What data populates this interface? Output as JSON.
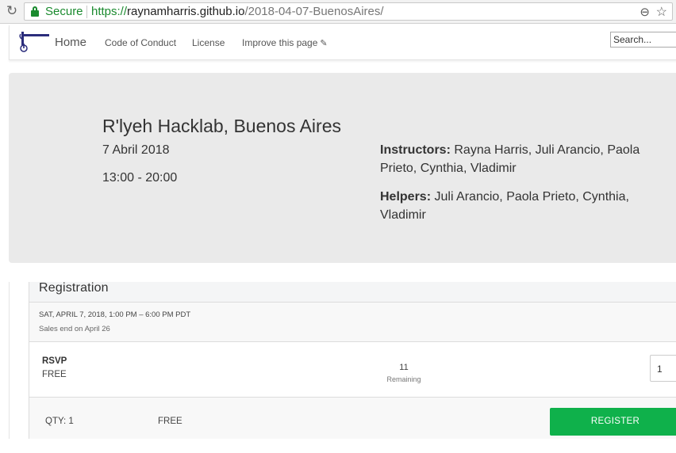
{
  "browser": {
    "secure_label": "Secure",
    "url_scheme": "https://",
    "url_host": "raynamharris.github.io",
    "url_path": "/2018-04-07-BuenosAires/",
    "reload_icon": "reload-icon",
    "zoom_icon": "zoom-icon",
    "bookmark_icon": "star-icon"
  },
  "nav": {
    "home": "Home",
    "links": [
      "Code of Conduct",
      "License",
      "Improve this page"
    ],
    "search_placeholder": "Search..."
  },
  "workshop": {
    "title": "R'lyeh Hacklab, Buenos Aires",
    "date": "7 Abril 2018",
    "time": "13:00 - 20:00",
    "instructors_label": "Instructors:",
    "instructors": "Rayna Harris, Juli Arancio, Paola Prieto, Cynthia, Vladimir",
    "helpers_label": "Helpers:",
    "helpers": "Juli Arancio, Paola Prieto, Cynthia, Vladimir"
  },
  "registration": {
    "title": "Registration",
    "event_date": "SAT, APRIL 7, 2018, 1:00 PM – 6:00 PM PDT",
    "sales_end": "Sales end on April 26",
    "ticket_name": "RSVP",
    "ticket_price": "FREE",
    "remaining_count": "11",
    "remaining_label": "Remaining",
    "qty_value": "1",
    "footer_qty": "QTY: 1",
    "footer_total": "FREE",
    "register_label": "REGISTER"
  },
  "colors": {
    "secure_green": "#1a8a2e",
    "register_green": "#0fb14b",
    "hero_bg": "#eaeaea",
    "logo_blue": "#2b2d7c"
  }
}
